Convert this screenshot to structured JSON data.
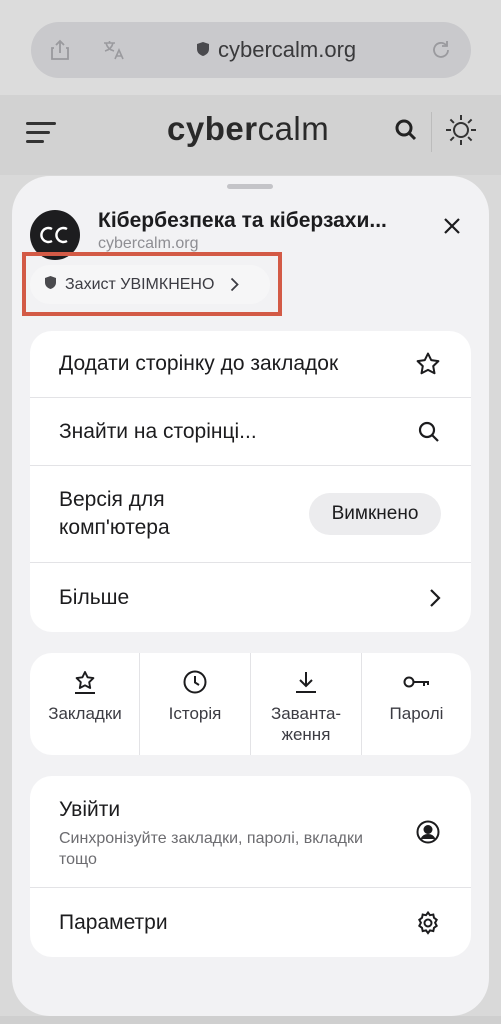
{
  "browser": {
    "url": "cybercalm.org"
  },
  "site_header": {
    "logo_bold": "cyber",
    "logo_light": "calm"
  },
  "sheet": {
    "site_title": "Кібербезпека та кіберзахи...",
    "site_domain": "cybercalm.org",
    "site_logo_text": "CC",
    "protection_label": "Захист УВІМКНЕНО"
  },
  "menu": {
    "items": [
      {
        "label": "Додати сторінку до закладок",
        "icon": "star-icon"
      },
      {
        "label": "Знайти на сторінці...",
        "icon": "search-icon"
      },
      {
        "label_line1": "Версія для",
        "label_line2": "комп'ютера",
        "value": "Вимкнено"
      },
      {
        "label": "Більше",
        "icon": "chevron-right-icon"
      }
    ]
  },
  "quick_actions": [
    {
      "label": "Закладки",
      "icon": "bookmark-star-icon"
    },
    {
      "label": "Історія",
      "icon": "clock-icon"
    },
    {
      "label_line1": "Заванта-",
      "label_line2": "ження",
      "icon": "download-icon"
    },
    {
      "label": "Паролі",
      "icon": "key-icon"
    }
  ],
  "account": {
    "signin_title": "Увійти",
    "signin_subtitle": "Синхронізуйте закладки, паролі, вкладки тощо",
    "settings_label": "Параметри"
  },
  "colors": {
    "highlight_border": "#d35a46",
    "sheet_background": "#f2f2f4",
    "card_background": "#ffffff"
  }
}
